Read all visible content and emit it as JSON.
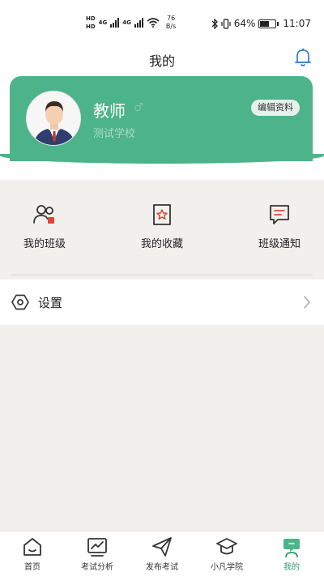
{
  "status_bar": {
    "network_top": "HD",
    "network_bottom": "HD",
    "signal1": "4G",
    "signal2": "4G",
    "speed_value": "76",
    "speed_unit": "B/s",
    "battery": "64%",
    "time": "11:07"
  },
  "header": {
    "title": "我的"
  },
  "profile": {
    "name": "教师",
    "school": "测试学校",
    "edit_label": "编辑资料"
  },
  "menu": [
    {
      "label": "我的班级",
      "icon": "people-icon"
    },
    {
      "label": "我的收藏",
      "icon": "star-bookmark-icon"
    },
    {
      "label": "班级通知",
      "icon": "chat-notice-icon"
    }
  ],
  "settings": {
    "label": "设置"
  },
  "tabs": [
    {
      "label": "首页",
      "icon": "home-icon"
    },
    {
      "label": "考试分析",
      "icon": "chart-icon"
    },
    {
      "label": "发布考试",
      "icon": "send-icon"
    },
    {
      "label": "小凡学院",
      "icon": "graduation-cap-icon"
    },
    {
      "label": "我的",
      "icon": "profile-icon"
    }
  ],
  "colors": {
    "accent": "#4db38a",
    "active_tab": "#2c9c6f",
    "bell": "#3d7fd6",
    "badge_red": "#d9473b"
  },
  "battery_level": 0.64
}
